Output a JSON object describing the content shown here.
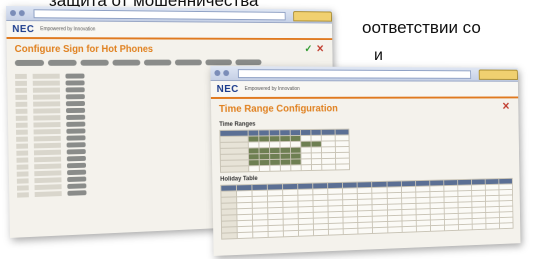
{
  "slide": {
    "line1": "защита от мошенничества",
    "line2": "оответствии со",
    "line3": "и"
  },
  "back_window": {
    "logo": "NEC",
    "tagline": "Empowered by Innovation",
    "title": "Configure Sign for Hot Phones"
  },
  "front_window": {
    "logo": "NEC",
    "tagline": "Empowered by Innovation",
    "title": "Time Range Configuration",
    "section_time_ranges": "Time Ranges",
    "section_holiday": "Holiday Table"
  },
  "colors": {
    "accent": "#e0801e",
    "brand": "#1a3b8c"
  }
}
